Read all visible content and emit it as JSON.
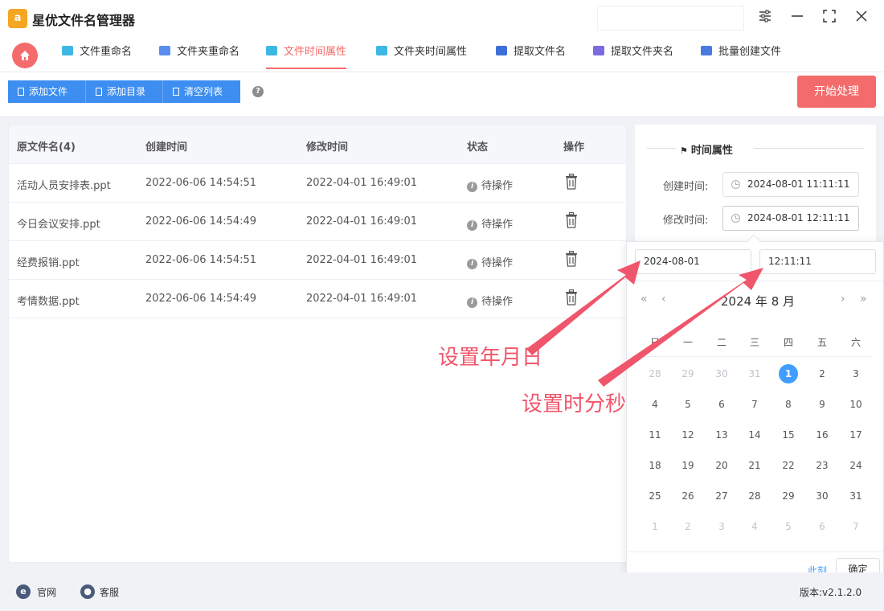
{
  "app": {
    "title": "星优文件名管理器",
    "logo_text": "a"
  },
  "tabs": [
    {
      "label": "文件重命名",
      "icon": "rename-file-icon",
      "color": "#3db7e4"
    },
    {
      "label": "文件夹重命名",
      "icon": "rename-folder-icon",
      "color": "#5b8def"
    },
    {
      "label": "文件时间属性",
      "icon": "file-time-icon",
      "color": "#3db7e4"
    },
    {
      "label": "文件夹时间属性",
      "icon": "folder-time-icon",
      "color": "#3db7e4"
    },
    {
      "label": "提取文件名",
      "icon": "extract-filename-icon",
      "color": "#3d6fd8"
    },
    {
      "label": "提取文件夹名",
      "icon": "extract-foldername-icon",
      "color": "#7a6be0"
    },
    {
      "label": "批量创建文件",
      "icon": "batch-create-icon",
      "color": "#4a7ae0"
    }
  ],
  "toolbar": {
    "add_file": "添加文件",
    "add_dir": "添加目录",
    "clear_list": "清空列表",
    "help": "?",
    "start": "开始处理"
  },
  "table": {
    "headers": [
      "原文件名(4)",
      "创建时间",
      "修改时间",
      "状态",
      "操作"
    ],
    "rows": [
      {
        "name": "活动人员安排表.ppt",
        "created": "2022-06-06 14:54:51",
        "modified": "2022-04-01 16:49:01",
        "status": "待操作"
      },
      {
        "name": "今日会议安排.ppt",
        "created": "2022-06-06 14:54:49",
        "modified": "2022-04-01 16:49:01",
        "status": "待操作"
      },
      {
        "name": "经费报销.ppt",
        "created": "2022-06-06 14:54:51",
        "modified": "2022-04-01 16:49:01",
        "status": "待操作"
      },
      {
        "name": "考情数据.ppt",
        "created": "2022-06-06 14:54:49",
        "modified": "2022-04-01 16:49:01",
        "status": "待操作"
      }
    ]
  },
  "time_panel": {
    "title": "时间属性",
    "created_label": "创建时间:",
    "created_value": "2024-08-01 11:11:11",
    "modified_label": "修改时间:",
    "modified_value": "2024-08-01 12:11:11"
  },
  "picker": {
    "date_value": "2024-08-01",
    "time_value": "12:11:11",
    "header": "2024 年 8 月",
    "weekdays": [
      "日",
      "一",
      "二",
      "三",
      "四",
      "五",
      "六"
    ],
    "weeks": [
      [
        "28",
        "29",
        "30",
        "31",
        "1",
        "2",
        "3"
      ],
      [
        "4",
        "5",
        "6",
        "7",
        "8",
        "9",
        "10"
      ],
      [
        "11",
        "12",
        "13",
        "14",
        "15",
        "16",
        "17"
      ],
      [
        "18",
        "19",
        "20",
        "21",
        "22",
        "23",
        "24"
      ],
      [
        "25",
        "26",
        "27",
        "28",
        "29",
        "30",
        "31"
      ],
      [
        "1",
        "2",
        "3",
        "4",
        "5",
        "6",
        "7"
      ]
    ],
    "selected_day": "1",
    "now_label": "此刻",
    "ok_label": "确定"
  },
  "annotations": {
    "date_note": "设置年月日",
    "time_note": "设置时分秒",
    "color": "#f0566b"
  },
  "statusbar": {
    "website": "官网",
    "support": "客服",
    "version": "版本:v2.1.2.0"
  }
}
